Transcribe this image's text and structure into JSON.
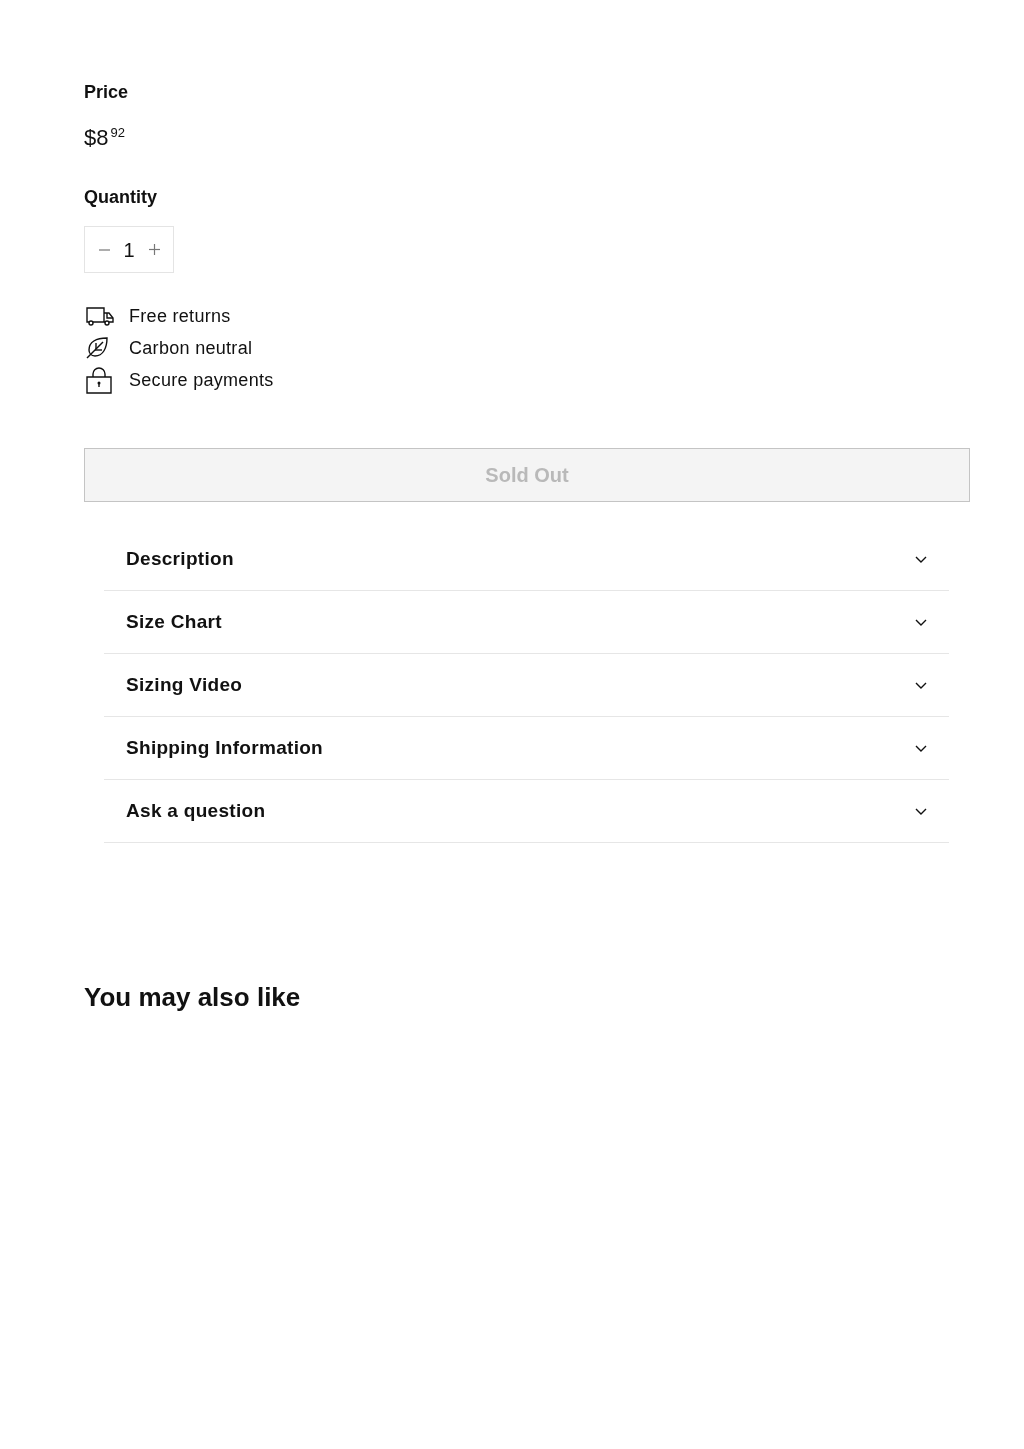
{
  "price": {
    "label": "Price",
    "whole": "$8",
    "cents": "92"
  },
  "quantity": {
    "label": "Quantity",
    "value": "1"
  },
  "features": [
    {
      "kind": "truck",
      "label": "Free returns"
    },
    {
      "kind": "leaf",
      "label": "Carbon neutral"
    },
    {
      "kind": "lock",
      "label": "Secure payments"
    }
  ],
  "add_button": {
    "label": "Sold Out",
    "disabled": true
  },
  "accordion": [
    {
      "label": "Description",
      "expanded": false
    },
    {
      "label": "Size Chart",
      "expanded": false
    },
    {
      "label": "Sizing Video",
      "expanded": false
    },
    {
      "label": "Shipping Information",
      "expanded": false
    },
    {
      "label": "Ask a question",
      "expanded": false
    }
  ],
  "related": {
    "heading": "You may also like"
  }
}
